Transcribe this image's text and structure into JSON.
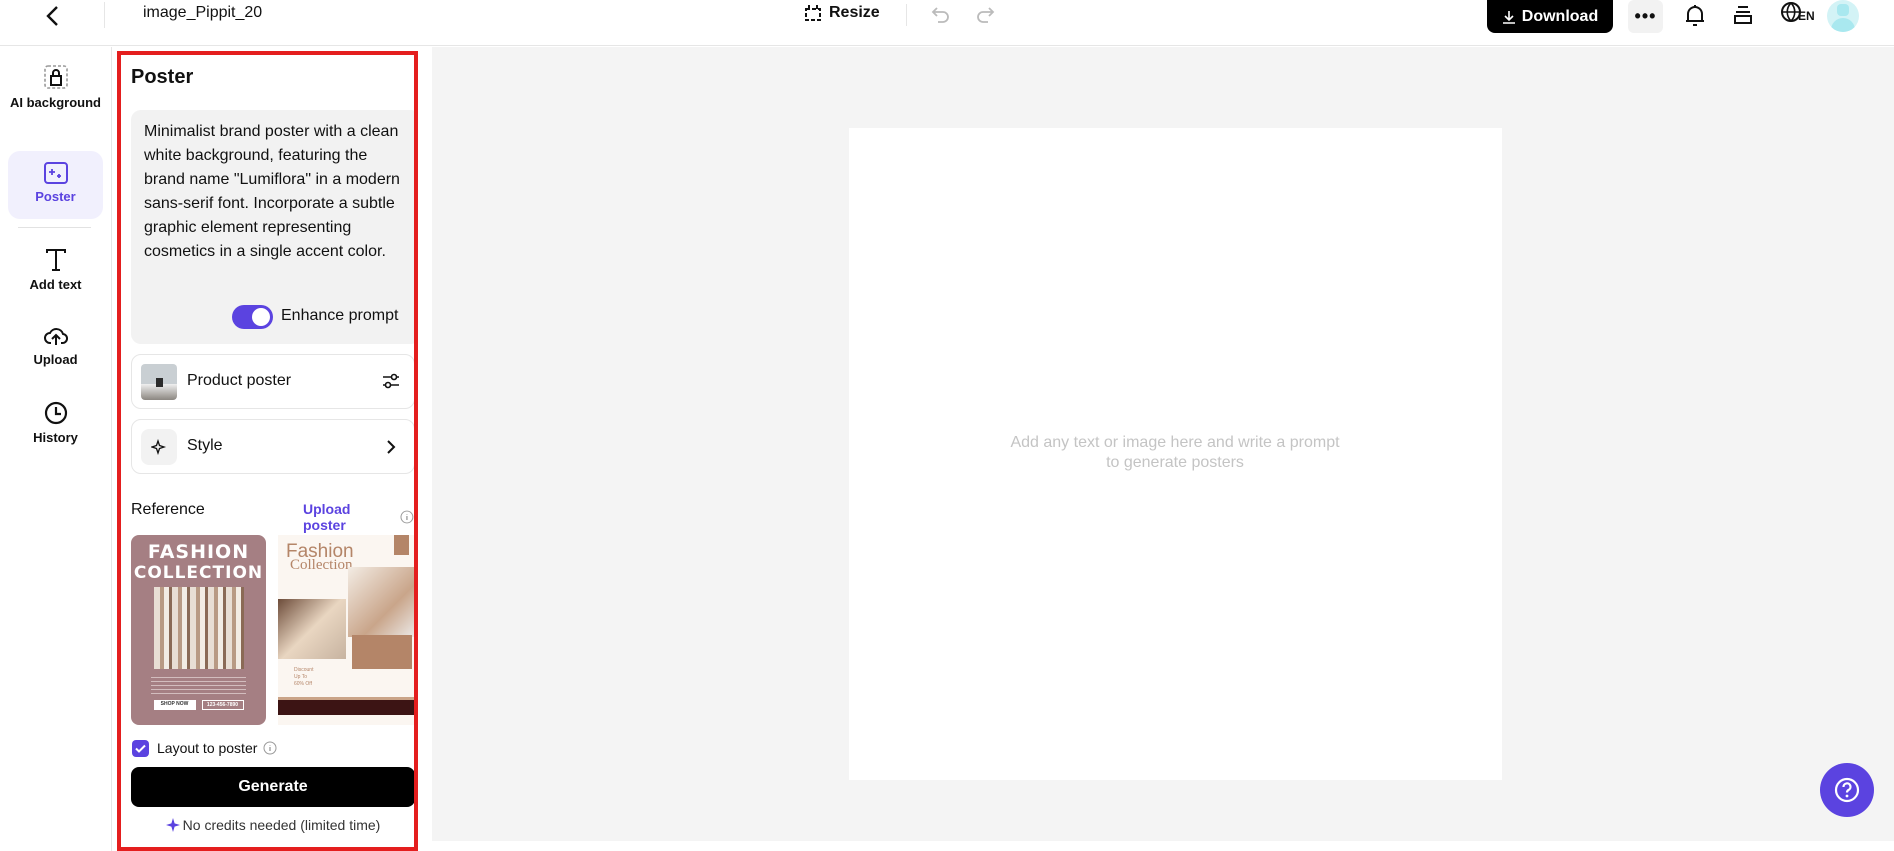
{
  "header": {
    "file_name": "image_Pippit_20",
    "resize_label": "Resize",
    "download_label": "Download",
    "language": "EN"
  },
  "nav": {
    "items": [
      {
        "label": "AI background",
        "icon": "ai-background-icon"
      },
      {
        "label": "Poster",
        "icon": "poster-icon",
        "active": true
      },
      {
        "label": "Add text",
        "icon": "text-icon"
      },
      {
        "label": "Upload",
        "icon": "upload-icon"
      },
      {
        "label": "History",
        "icon": "history-icon"
      }
    ]
  },
  "panel": {
    "title": "Poster",
    "prompt": "Minimalist brand poster with a clean white background, featuring the brand name \"Lumiflora\" in a modern sans-serif font. Incorporate a subtle graphic element representing cosmetics in a single accent color.",
    "enhance_label": "Enhance prompt",
    "enhance_on": true,
    "product_poster_label": "Product poster",
    "style_label": "Style",
    "reference_label": "Reference",
    "upload_poster_label": "Upload poster",
    "references": [
      {
        "title1": "FASHION",
        "title2": "COLLECTION",
        "btn1": "SHOP NOW",
        "btn2": "123-456-7890"
      },
      {
        "title1": "Fashion",
        "title2": "Collection",
        "discount1": "Discount",
        "discount2": "Up To",
        "discount3": "60% Off"
      }
    ],
    "layout_label": "Layout to poster",
    "layout_checked": true,
    "generate_label": "Generate",
    "credits_note": "No credits needed (limited time)"
  },
  "canvas": {
    "placeholder": "Add any text or image here and write a prompt to generate posters"
  },
  "colors": {
    "accent": "#5b43e0",
    "red_outline": "#e41e1e",
    "canvas_bg": "#f4f4f4"
  }
}
